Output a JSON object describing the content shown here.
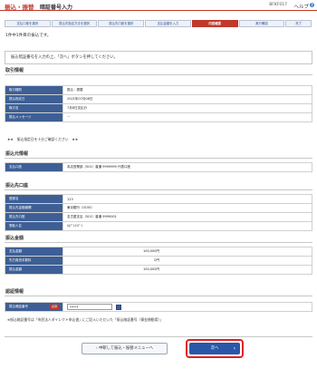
{
  "header": {
    "title": "振込・振替",
    "subtitle": "暗証番号入力",
    "screen_id": "BFKF017",
    "help_label": "ヘルプ"
  },
  "steps": [
    {
      "label": "支払口座を選択"
    },
    {
      "label": "振込先指定方法を選択"
    },
    {
      "label": "振込先口座を選択"
    },
    {
      "label": "支払金額を入力"
    },
    {
      "label": "内容確認",
      "active": true
    },
    {
      "label": "実行確認"
    },
    {
      "label": "完了"
    }
  ],
  "batch_note": "1件中1件目の振込です。",
  "info_message": "振込暗証番号を入力の上、「次へ」ボタンを押してください。",
  "sections": {
    "transaction": {
      "title": "取引情報",
      "rows": [
        {
          "label": "取引種別",
          "value": "振込・振替"
        },
        {
          "label": "振込指定日",
          "value": "2021年07月08日"
        },
        {
          "label": "取引名",
          "value": "7月8日支払分"
        },
        {
          "label": "振込メッセージ",
          "value": "－"
        }
      ],
      "note": "★★　振込指定日を十分ご確認ください　★★"
    },
    "source": {
      "title": "振込元情報",
      "rows": [
        {
          "label": "支払口座",
          "value": "本店営業部（501）普通 9999999 代表口座"
        }
      ]
    },
    "destination": {
      "title": "振込先口座",
      "rows": [
        {
          "label": "登録名",
          "value": "123"
        },
        {
          "label": "振込先金融機関",
          "value": "東京銀行（0155）"
        },
        {
          "label": "振込先口座",
          "value": "名古屋支店（501）普通 9999001"
        },
        {
          "label": "受取人名",
          "value": "ｶ)ﾃﾞｲｴｲﾃﾞｲ"
        }
      ]
    },
    "amount": {
      "title": "振込金額",
      "rows": [
        {
          "label": "支払金額",
          "value": "100,000円"
        },
        {
          "label": "先方負担手数料",
          "value": "0円"
        },
        {
          "label": "振込金額",
          "value": "100,000円"
        }
      ]
    },
    "auth": {
      "title": "認証情報",
      "row_label": "振込暗証番号",
      "required_label": "必須",
      "input_value": "••••",
      "note": "※振込暗証番号は「市民法人ダイレクト申込書」にご記入いただいた「振込暗証番号（資金移動用）」"
    }
  },
  "buttons": {
    "back": "中断して振込・振替メニューへ",
    "next": "次へ"
  }
}
